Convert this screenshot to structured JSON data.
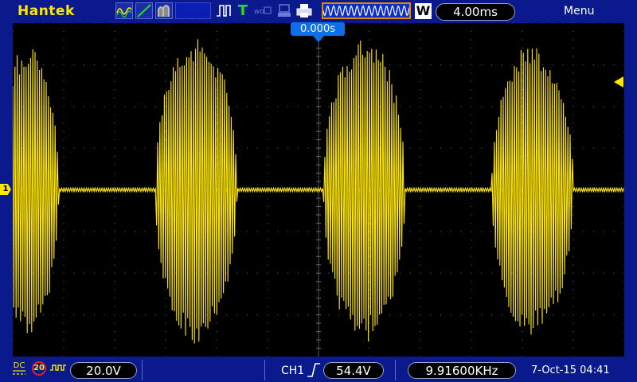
{
  "brand": "Hantek",
  "menu_label": "Menu",
  "timebase": "4.00ms",
  "acquire_mode": "W",
  "trigger_position": "0.000s",
  "channel": {
    "marker": "1",
    "coupling": "DC",
    "bandwidth_limit": "20",
    "volts_per_div": "20.0V",
    "color": "#ffe600"
  },
  "trigger": {
    "source": "CH1",
    "level": "54.4V",
    "frequency": "9.91600KHz"
  },
  "datetime": "7-Oct-15 04:41",
  "icons": [
    "waveform-icon",
    "slope-icon",
    "persist-icon",
    "pulse-icon",
    "trigger-T-icon",
    "network-icon",
    "usb-icon",
    "printer-icon",
    "acquisition-wave-icon",
    "trigger-rising-edge-icon",
    "probe-icon"
  ],
  "colors": {
    "background": "#0a1a8c",
    "accent": "#0f6fe8",
    "trace": "#ffe600"
  },
  "chart_data": {
    "type": "line",
    "title": "",
    "xlabel": "",
    "ylabel": "",
    "grid": true,
    "description_divisions": {
      "x": 12,
      "y": 8
    },
    "bursts_center_div": [
      0.3,
      3.6,
      6.9,
      10.2
    ],
    "burst_halfwidth_div": [
      0.6,
      0.8,
      0.8,
      0.8
    ],
    "burst_amplitude_div": [
      3.5,
      3.7,
      3.7,
      3.5
    ],
    "baseline_div": 0.0
  }
}
